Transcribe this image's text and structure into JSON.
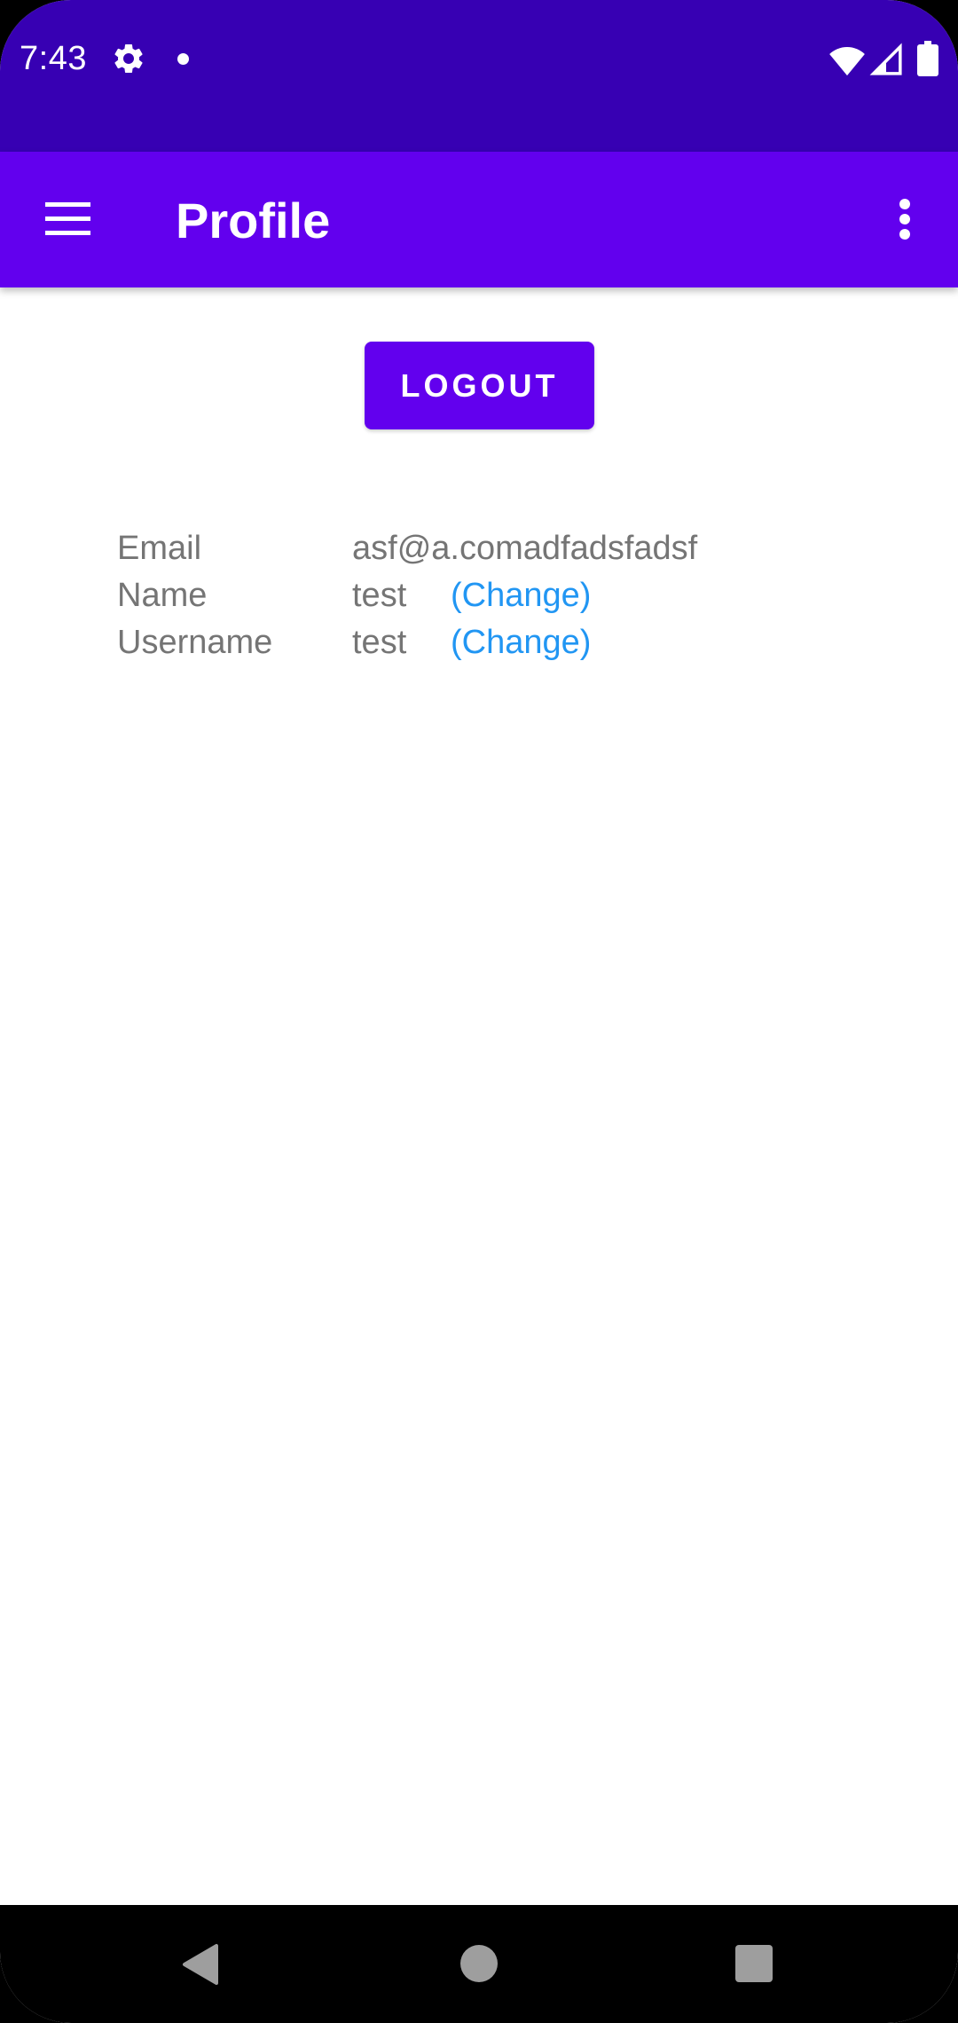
{
  "status_bar": {
    "time": "7:43",
    "icons": [
      "gear-icon",
      "notification-dot-icon",
      "wifi-icon",
      "cell-signal-icon",
      "battery-icon"
    ]
  },
  "app_bar": {
    "title": "Profile",
    "menu_icon": "hamburger-menu-icon",
    "overflow_icon": "more-vert-icon",
    "background_color": "#6200ee"
  },
  "logout_button": {
    "label": "LOGOUT"
  },
  "profile": {
    "rows": [
      {
        "label": "Email",
        "value": "asf@a.comadfadsfadsf"
      },
      {
        "label": "Name",
        "value": "test",
        "action": "(Change)"
      },
      {
        "label": "Username",
        "value": "test",
        "action": "(Change)"
      }
    ]
  },
  "nav_bar": {
    "icons": [
      "back-icon",
      "home-icon",
      "recents-icon"
    ]
  },
  "colors": {
    "status_bar": "#3700b3",
    "primary": "#6200ee",
    "link": "#2196f3",
    "text_secondary": "#757575"
  }
}
